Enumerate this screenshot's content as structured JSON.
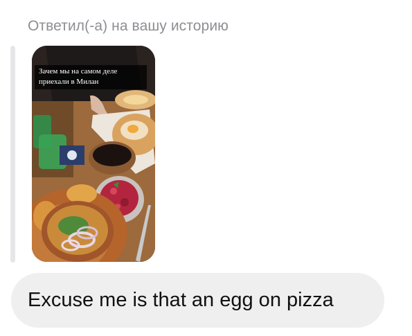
{
  "reply": {
    "header": "Ответил(-а) на вашу историю"
  },
  "story": {
    "caption": "Зачем мы на самом деле приехали в Милан",
    "image_description_icon": "food-photo"
  },
  "message": {
    "text": "Excuse me is that an egg on pizza"
  },
  "colors": {
    "header_text": "#8e8e93",
    "bubble_bg": "#efeff0",
    "reply_bar": "#e6e6e9"
  }
}
